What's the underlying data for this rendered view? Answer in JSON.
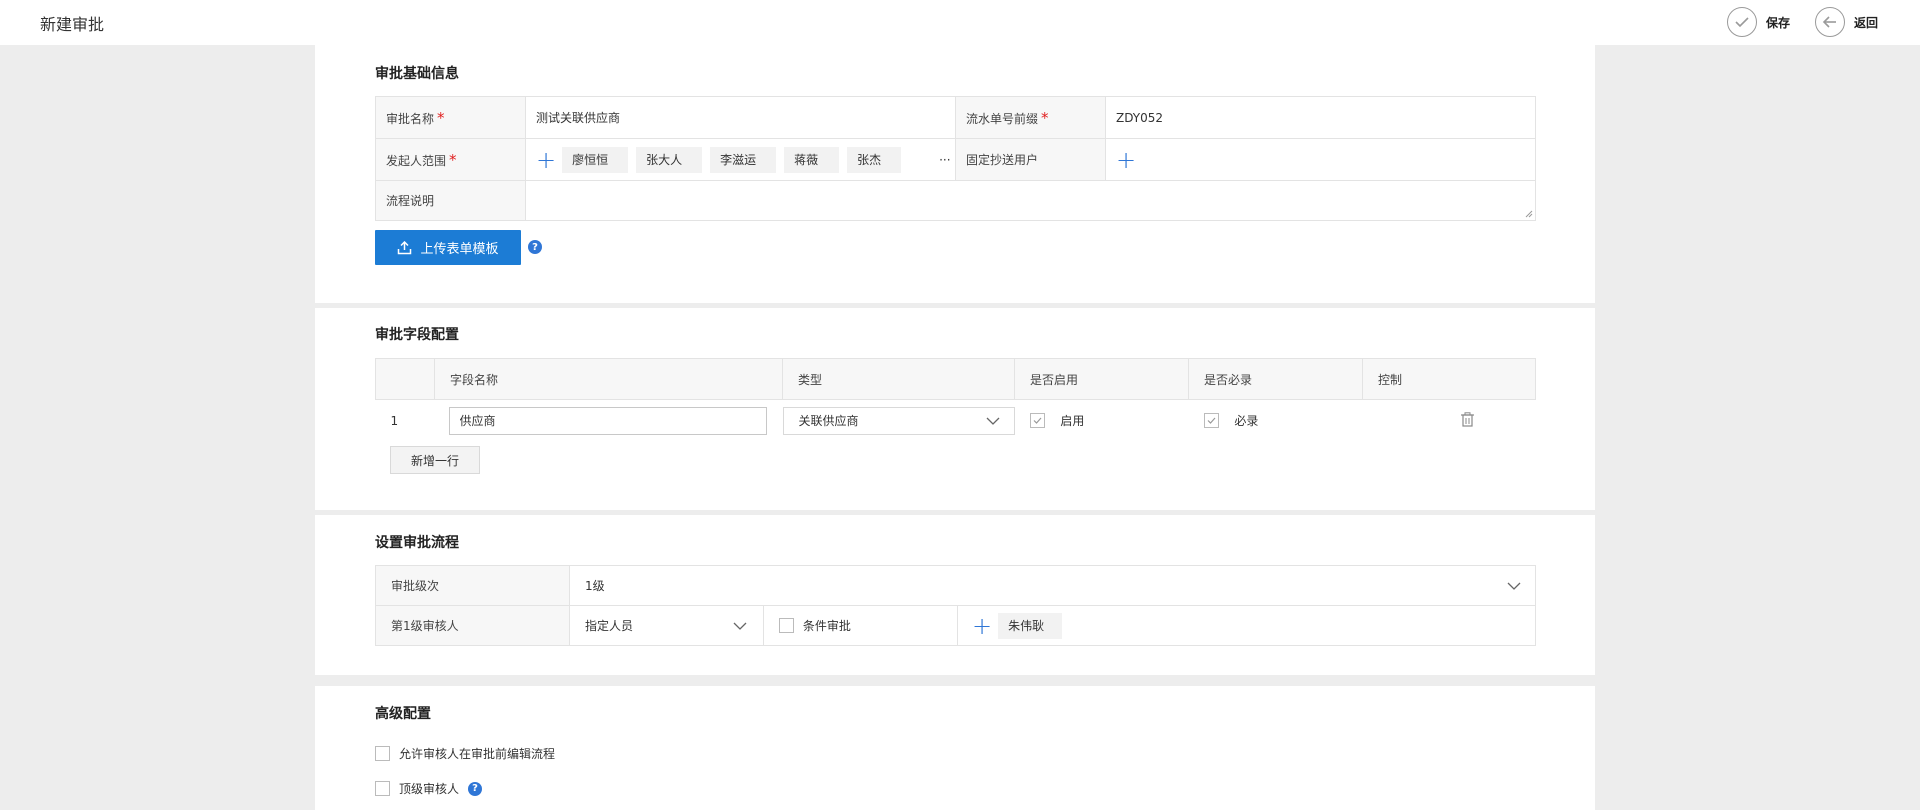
{
  "header": {
    "title": "新建审批",
    "save_label": "保存",
    "back_label": "返回"
  },
  "basic": {
    "section_title": "审批基础信息",
    "name_label": "审批名称",
    "name_value": "测试关联供应商",
    "prefix_label": "流水单号前缀",
    "prefix_value": "ZDY052",
    "initiator_label": "发起人范围",
    "initiators": [
      "廖恒恒",
      "张大人",
      "李滋运",
      "蒋薇",
      "张杰"
    ],
    "more": "···",
    "cc_label": "固定抄送用户",
    "desc_label": "流程说明",
    "upload_label": "上传表单模板",
    "help_glyph": "?"
  },
  "fields": {
    "section_title": "审批字段配置",
    "columns": [
      "字段名称",
      "类型",
      "是否启用",
      "是否必录",
      "控制"
    ],
    "rows": [
      {
        "index": "1",
        "name": "供应商",
        "type": "关联供应商",
        "enabled_label": "启用",
        "enabled": true,
        "required_label": "必录",
        "required": true
      }
    ],
    "add_row_label": "新增一行"
  },
  "flow": {
    "section_title": "设置审批流程",
    "level_label": "审批级次",
    "level_value": "1级",
    "reviewer_label": "第1级审核人",
    "reviewer_type": "指定人员",
    "condition_label": "条件审批",
    "reviewer": "朱伟耿"
  },
  "advanced": {
    "section_title": "高级配置",
    "options": [
      "允许审核人在审批前编辑流程",
      "顶级审核人"
    ]
  },
  "colors": {
    "accent": "#1c7cd5",
    "highlight": "#e83434",
    "required": "#e02020"
  }
}
